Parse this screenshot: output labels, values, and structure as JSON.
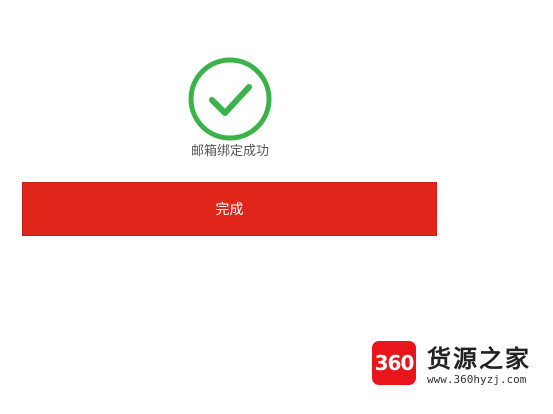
{
  "success": {
    "icon": "check-circle-icon",
    "message": "邮箱绑定成功",
    "color": "#3cb34a"
  },
  "actions": {
    "done_label": "完成",
    "button_color": "#e0251b"
  },
  "watermark": {
    "logo_text": "360",
    "title": "货源之家",
    "url": "www.360hyzj.com",
    "brand_color": "#e8161a"
  }
}
